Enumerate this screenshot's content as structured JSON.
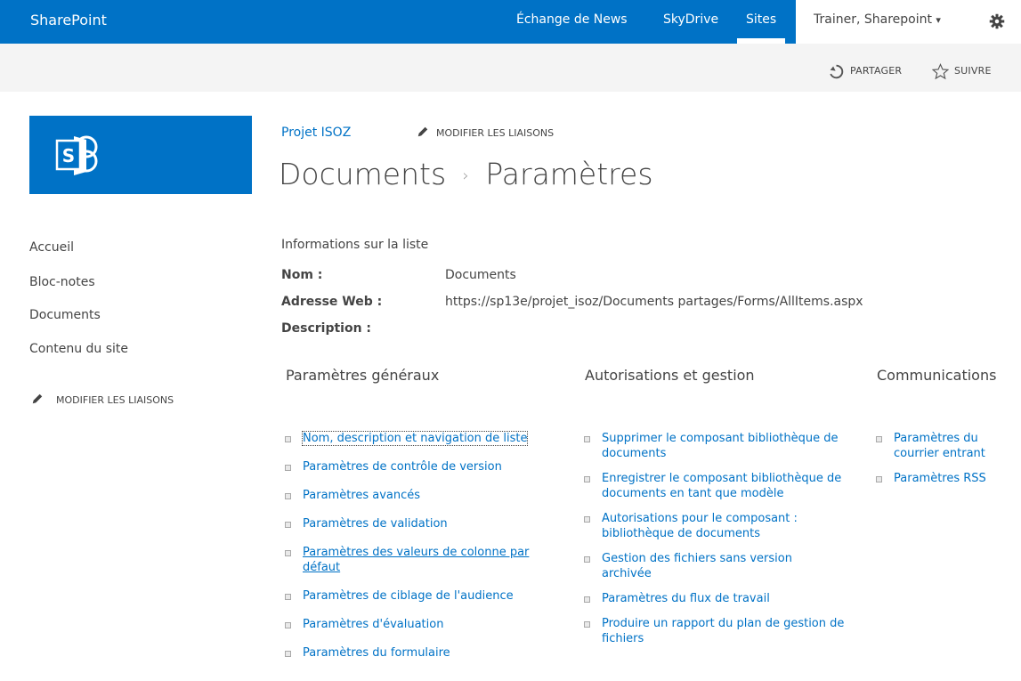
{
  "suite_bar": {
    "brand": "SharePoint",
    "nav": [
      "Échange de News",
      "SkyDrive",
      "Sites"
    ],
    "selected": "Sites",
    "user": "Trainer, Sharepoint",
    "user_caret": "▾"
  },
  "actions": {
    "share": "PARTAGER",
    "follow": "SUIVRE"
  },
  "header": {
    "breadcrumb_link": "Projet ISOZ",
    "edit_links": "MODIFIER LES LIAISONS",
    "title_part1": "Documents",
    "title_separator": "›",
    "title_part2": "Paramètres"
  },
  "quick_launch": {
    "items": [
      "Accueil",
      "Bloc-notes",
      "Documents",
      "Contenu du site"
    ],
    "edit_links": "MODIFIER LES LIAISONS"
  },
  "list_info": {
    "heading": "Informations sur la liste",
    "name_label": "Nom :",
    "name_value": "Documents",
    "web_address_label": "Adresse Web :",
    "web_address_value": "https://sp13e/projet_isoz/Documents partages/Forms/AllItems.aspx",
    "description_label": "Description :"
  },
  "columns": [
    {
      "heading": "Paramètres généraux",
      "links": [
        "Nom, description et navigation de liste",
        "Paramètres de contrôle de version",
        "Paramètres avancés",
        "Paramètres de validation",
        "Paramètres des valeurs de colonne par défaut",
        "Paramètres de ciblage de l'audience",
        "Paramètres d'évaluation",
        "Paramètres du formulaire"
      ]
    },
    {
      "heading": "Autorisations et gestion",
      "links": [
        "Supprimer le composant bibliothèque de documents",
        "Enregistrer le composant bibliothèque de documents en tant que modèle",
        "Autorisations pour le composant : bibliothèque de documents",
        "Gestion des fichiers sans version archivée",
        "Paramètres du flux de travail",
        "Produire un rapport du plan de gestion de fichiers"
      ]
    },
    {
      "heading": "Communications",
      "links": [
        "Paramètres du courrier entrant",
        "Paramètres RSS"
      ]
    }
  ],
  "colors": {
    "suite_blue": "#0072c6",
    "text": "#444444",
    "link": "#0072c6",
    "bar_gray": "#f4f4f4"
  },
  "icons": [
    "gear-icon",
    "share-icon",
    "follow-star-icon",
    "pencil-icon",
    "sharepoint-logo-icon",
    "bullet-icon"
  ]
}
